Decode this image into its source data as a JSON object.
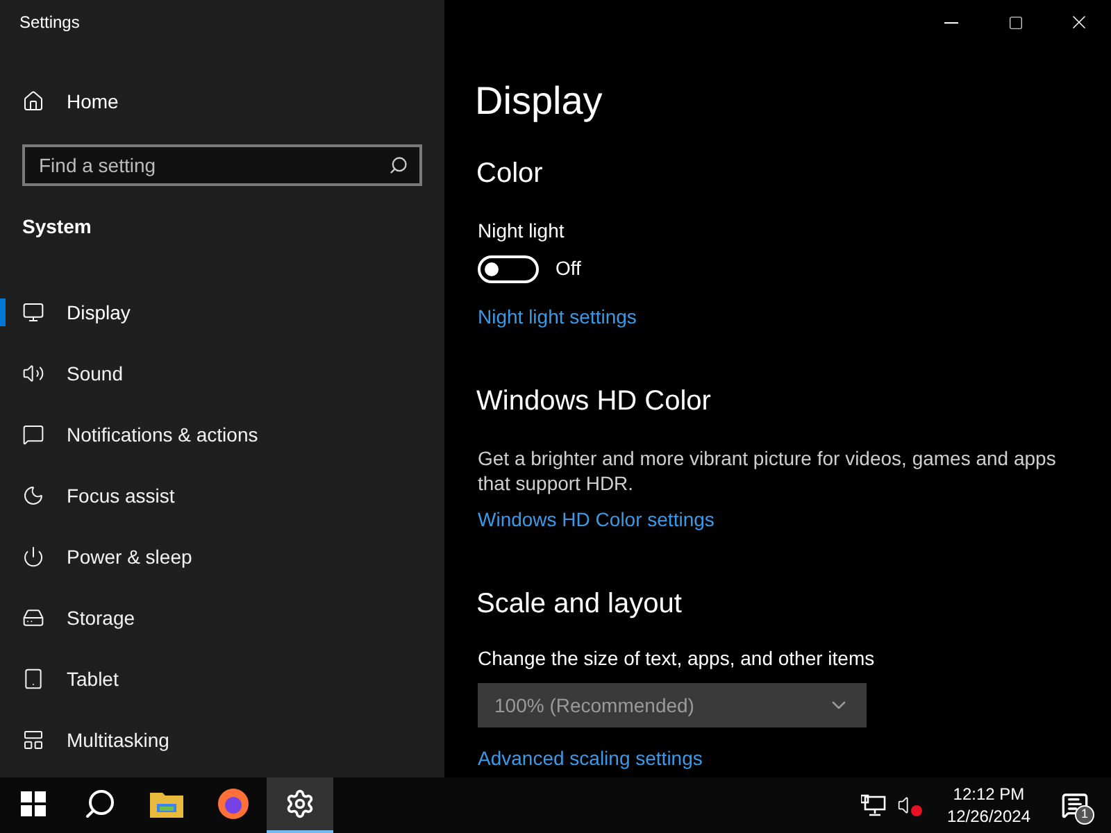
{
  "window": {
    "title": "Settings"
  },
  "sidebar": {
    "home": "Home",
    "search": {
      "placeholder": "Find a setting"
    },
    "section": "System",
    "items": [
      {
        "label": "Display",
        "kind": "display",
        "selected": true
      },
      {
        "label": "Sound",
        "kind": "sound",
        "selected": false
      },
      {
        "label": "Notifications & actions",
        "kind": "notifications",
        "selected": false
      },
      {
        "label": "Focus assist",
        "kind": "focus",
        "selected": false
      },
      {
        "label": "Power & sleep",
        "kind": "power",
        "selected": false
      },
      {
        "label": "Storage",
        "kind": "storage",
        "selected": false
      },
      {
        "label": "Tablet",
        "kind": "tablet",
        "selected": false
      },
      {
        "label": "Multitasking",
        "kind": "multitasking",
        "selected": false
      }
    ]
  },
  "page": {
    "title": "Display",
    "color": {
      "heading": "Color",
      "night_light": {
        "label": "Night light",
        "on": false,
        "state_text": "Off"
      },
      "link": "Night light settings"
    },
    "hd_color": {
      "heading": "Windows HD Color",
      "description": "Get a brighter and more vibrant picture for videos, games and apps that support HDR.",
      "link": "Windows HD Color settings"
    },
    "scale": {
      "heading": "Scale and layout",
      "label": "Change the size of text, apps, and other items",
      "dropdown_value": "100% (Recommended)",
      "link": "Advanced scaling settings"
    }
  },
  "taskbar": {
    "apps": [
      {
        "kind": "start",
        "selected": false
      },
      {
        "kind": "search",
        "selected": false
      },
      {
        "kind": "explorer",
        "selected": false
      },
      {
        "kind": "firefox",
        "selected": false
      },
      {
        "kind": "settings",
        "selected": true
      }
    ],
    "time": "12:12 PM",
    "date": "12/26/2024",
    "notification_count": "1"
  }
}
